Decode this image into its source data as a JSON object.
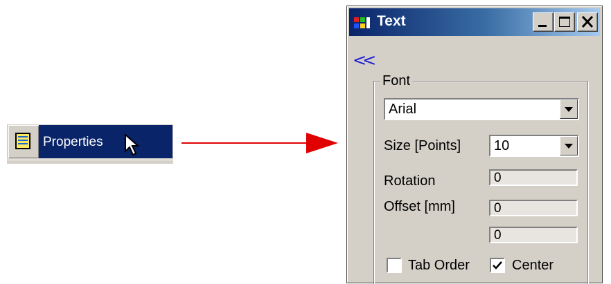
{
  "menu": {
    "item_label": "Properties",
    "icon": "properties-table-icon",
    "cursor_icon": "mouse-pointer-icon"
  },
  "dialog": {
    "title": "Text",
    "title_icon": "app-window-icon",
    "collapse_glyph": "<<",
    "font_group": {
      "legend": "Font",
      "font_value": "Arial",
      "size_label": "Size [Points]",
      "size_value": "10",
      "rotation_label": "Rotation",
      "rotation_value": "0",
      "offset_label": "Offset [mm]",
      "offset_x_value": "0",
      "offset_y_value": "0",
      "tab_order_label": "Tab Order",
      "tab_order_checked": false,
      "center_label": "Center",
      "center_checked": true
    }
  },
  "colors": {
    "title_gradient_start": "#0a246a",
    "menu_highlight": "#0a246a",
    "arrow": "#e00000",
    "window_face": "#d4d0c8"
  }
}
